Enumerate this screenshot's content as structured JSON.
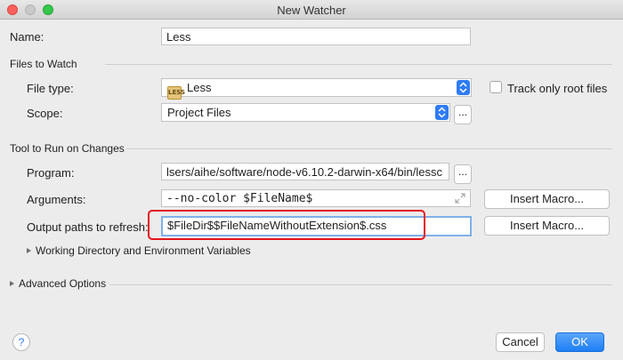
{
  "window": {
    "title": "New Watcher"
  },
  "name": {
    "label": "Name:",
    "value": "Less"
  },
  "files_to_watch": {
    "heading": "Files to Watch",
    "file_type_label": "File type:",
    "file_type_value": "Less",
    "file_type_icon": "less-file-icon",
    "track_label": "Track only root files",
    "track_checked": false,
    "scope_label": "Scope:",
    "scope_value": "Project Files",
    "scope_more": "..."
  },
  "tool": {
    "heading": "Tool to Run on Changes",
    "program_label": "Program:",
    "program_value": "lsers/aihe/software/node-v6.10.2-darwin-x64/bin/lessc",
    "program_more": "...",
    "arguments_label": "Arguments:",
    "arguments_value": "--no-color $FileName$",
    "insert_macro_1": "Insert Macro...",
    "output_label": "Output paths to refresh:",
    "output_value": "$FileDir$$FileNameWithoutExtension$.css",
    "insert_macro_2": "Insert Macro...",
    "working_dir_label": "Working Directory and Environment Variables"
  },
  "advanced": {
    "label": "Advanced Options"
  },
  "footer": {
    "help": "?",
    "cancel": "Cancel",
    "ok": "OK"
  },
  "colors": {
    "accent": "#2f7cf6",
    "highlight": "#e3151b"
  }
}
